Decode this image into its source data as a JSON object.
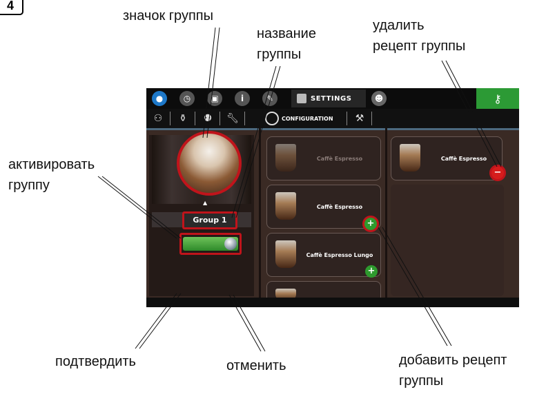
{
  "step_number": "4",
  "callouts": {
    "group_icon": "значок группы",
    "group_name": [
      "название",
      "группы"
    ],
    "delete_recipe": [
      "удалить",
      "рецепт группы"
    ],
    "activate_group": [
      "активировать",
      "группу"
    ],
    "confirm": "подтвердить",
    "cancel": "отменить",
    "add_recipe": [
      "добавить рецепт",
      "группы"
    ]
  },
  "screen": {
    "topbar": {
      "icons": [
        "water-drop-icon",
        "clock-icon",
        "cup-icon",
        "info-icon",
        "pencil-icon"
      ],
      "settings_label": "SETTINGS",
      "key_icon": "key-icon"
    },
    "subbar": {
      "configuration_label": "CONFIGURATION"
    },
    "group": {
      "name": "Group 1",
      "active": true
    },
    "available_recipes": [
      {
        "name": "Caffè Espresso",
        "enabled": false
      },
      {
        "name": "Caffè Espresso",
        "enabled": true
      },
      {
        "name": "Caffè Espresso Lungo",
        "enabled": true
      }
    ],
    "group_recipes": [
      {
        "name": "Caffè Espresso"
      }
    ]
  },
  "colors": {
    "highlight_ring": "#c0141b",
    "accent_green": "#2c9a35",
    "panel_bg": "#3a2a24"
  }
}
